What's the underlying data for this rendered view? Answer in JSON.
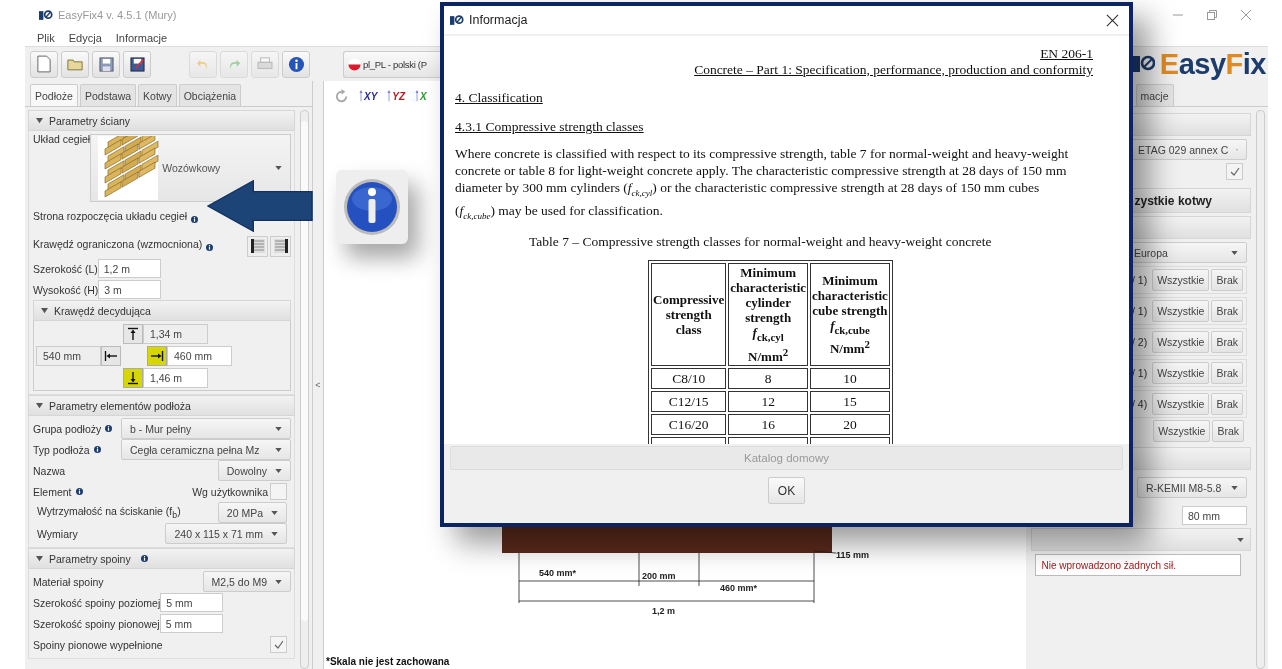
{
  "window": {
    "title": "EasyFix4 v. 4.5.1 (Mury)"
  },
  "menu": [
    "Plik",
    "Edycja",
    "Informacje"
  ],
  "language": {
    "value": "pl_PL - polski (P"
  },
  "logo": [
    {
      "text": "E",
      "color": "#e08a22"
    },
    {
      "text": "asy",
      "color": "#1c3c6e"
    },
    {
      "text": "F",
      "color": "#e08a22"
    },
    {
      "text": "ix",
      "color": "#1c3c6e"
    }
  ],
  "view_buttons": [
    {
      "label": "XY",
      "color": "#2a2a9a"
    },
    {
      "label": "YZ",
      "color": "#b02020"
    },
    {
      "label": "X",
      "color": "#2a9a2a"
    }
  ],
  "left_panel": {
    "tabs": [
      {
        "label": "Podłoże",
        "selected": true
      },
      {
        "label": "Podstawa",
        "selected": false
      },
      {
        "label": "Kotwy",
        "selected": false
      },
      {
        "label": "Obciążenia",
        "selected": false
      }
    ],
    "sections": [
      {
        "title": "Parametry ściany",
        "expanded": true,
        "rows": [
          {
            "kind": "brick-select",
            "label": "Układ cegieł",
            "value": "Wozówkowy"
          },
          {
            "kind": "label",
            "label": "Strona rozpoczęcia układu cegieł",
            "info": true
          },
          {
            "kind": "edge-toggle",
            "label": "Krawędź ograniczona (wzmocniona)",
            "info": true
          },
          {
            "kind": "input",
            "label": "Szerokość (L)",
            "value": "1,2 m"
          },
          {
            "kind": "input",
            "label": "Wysokość (H)",
            "value": "3 m"
          },
          {
            "kind": "edges",
            "title": "Krawędź decydująca",
            "expanded": true,
            "edges": [
              {
                "kind": "top",
                "value": "1,34 m",
                "selected": false
              },
              {
                "kind": "left",
                "value": "540 mm",
                "selected": false
              },
              {
                "kind": "right",
                "value": "460 mm",
                "selected": true
              },
              {
                "kind": "bottom",
                "value": "1,46 m",
                "selected": true
              }
            ]
          }
        ]
      },
      {
        "title": "Parametry elementów podłoża",
        "expanded": true,
        "rows": [
          {
            "kind": "select",
            "label": "Grupa podłoży",
            "info": true,
            "value": "b - Mur pełny"
          },
          {
            "kind": "select",
            "label": "Typ podłoża",
            "info": true,
            "value": "Cegła ceramiczna pełna Mz"
          },
          {
            "kind": "select",
            "label": "Nazwa",
            "value": "Dowolny"
          },
          {
            "kind": "checkbox",
            "label": "Element",
            "info": true,
            "check_label": "Wg użytkownika",
            "checked": false,
            "children": [
              {
                "kind": "select",
                "label": "Wytrzymałość na ściskanie (f$_{b}$)",
                "value": "20 MPa"
              },
              {
                "kind": "select",
                "label": "Wymiary",
                "value": "240 x 115 x 71 mm"
              }
            ]
          }
        ]
      },
      {
        "title": "Parametry spoiny",
        "info": true,
        "expanded": true,
        "rows": [
          {
            "kind": "select",
            "label": "Materiał spoiny",
            "value": "M2,5 do M9"
          },
          {
            "kind": "input",
            "label": "Szerokość spoiny poziomej",
            "value": "5 mm"
          },
          {
            "kind": "input",
            "label": "Szerokość spoiny pionowej",
            "value": "5 mm"
          },
          {
            "kind": "checkbox",
            "label": "Spoiny pionowe wypełnione",
            "checked": true
          }
        ]
      }
    ]
  },
  "collapse_handle": "<",
  "canvas": {
    "dimensions": {
      "left": "540 mm*",
      "middle": "200 mm",
      "right": "460 mm*",
      "total": "1,2 m",
      "depth": "115 mm"
    },
    "note": "*Skala nie jest zachowana"
  },
  "right_panel": {
    "tab": {
      "label": "macje",
      "selected": false
    },
    "norm": "ETAG 029 annex C",
    "norm_checked": true,
    "anchors_header": "zystkie kotwy",
    "region": "Europa",
    "filters": [
      {
        "count": "/ 1)",
        "all": "Wszystkie",
        "none": "Brak"
      },
      {
        "count": "/ 1)",
        "all": "Wszystkie",
        "none": "Brak"
      },
      {
        "count": "/ 2)",
        "all": "Wszystkie",
        "none": "Brak"
      },
      {
        "count": "/ 1)",
        "all": "Wszystkie",
        "none": "Brak"
      },
      {
        "count": "/ 4)",
        "all": "Wszystkie",
        "none": "Brak"
      }
    ],
    "filter_total": {
      "all": "Wszystkie",
      "none": "Brak"
    },
    "anchor": "R-KEMII M8-5.8",
    "depth": "80 mm",
    "loads_message": "Nie wprowadzono żadnych sił."
  },
  "dialog": {
    "title": "Informacja",
    "standard": "EN 206-1",
    "doc_title": "Concrete – Part 1: Specification, performance, production and conformity",
    "heading": "4. Classification",
    "subheading": "4.3.1 Compressive strength classes",
    "paragraph": "Where concrete is classified with respect to its compressive strength, table 7 for normal-weight and heavy-weight concrete or table 8 for light-weight concrete apply. The characteristic compressive strength at 28 days of 150 mm diameter by 300 mm cylinders (*f*$_{ck,cyl}$) or the characteristic compressive strength at 28 days of 150 mm cubes (*f*$_{ck,cube}$) may be used for classification.",
    "table_caption": "Table 7 – Compressive strength classes for normal-weight and heavy-weight concrete",
    "table": {
      "columns": [
        "Compressive\nstrength\nclass",
        "Minimum\ncharacteristic\ncylinder\nstrength\n*f*$_{ck,cyl}$\nN/mm$^{2}$",
        "Minimum\ncharacteristic\ncube strength\n*f*$_{ck,cube}$\nN/mm$^{2}$"
      ],
      "rows": [
        [
          "C8/10",
          "8",
          "10"
        ],
        [
          "C12/15",
          "12",
          "15"
        ],
        [
          "C16/20",
          "16",
          "20"
        ]
      ]
    },
    "catalog_button": {
      "label": "Katalog domowy",
      "disabled": true
    },
    "ok_button": "OK"
  }
}
